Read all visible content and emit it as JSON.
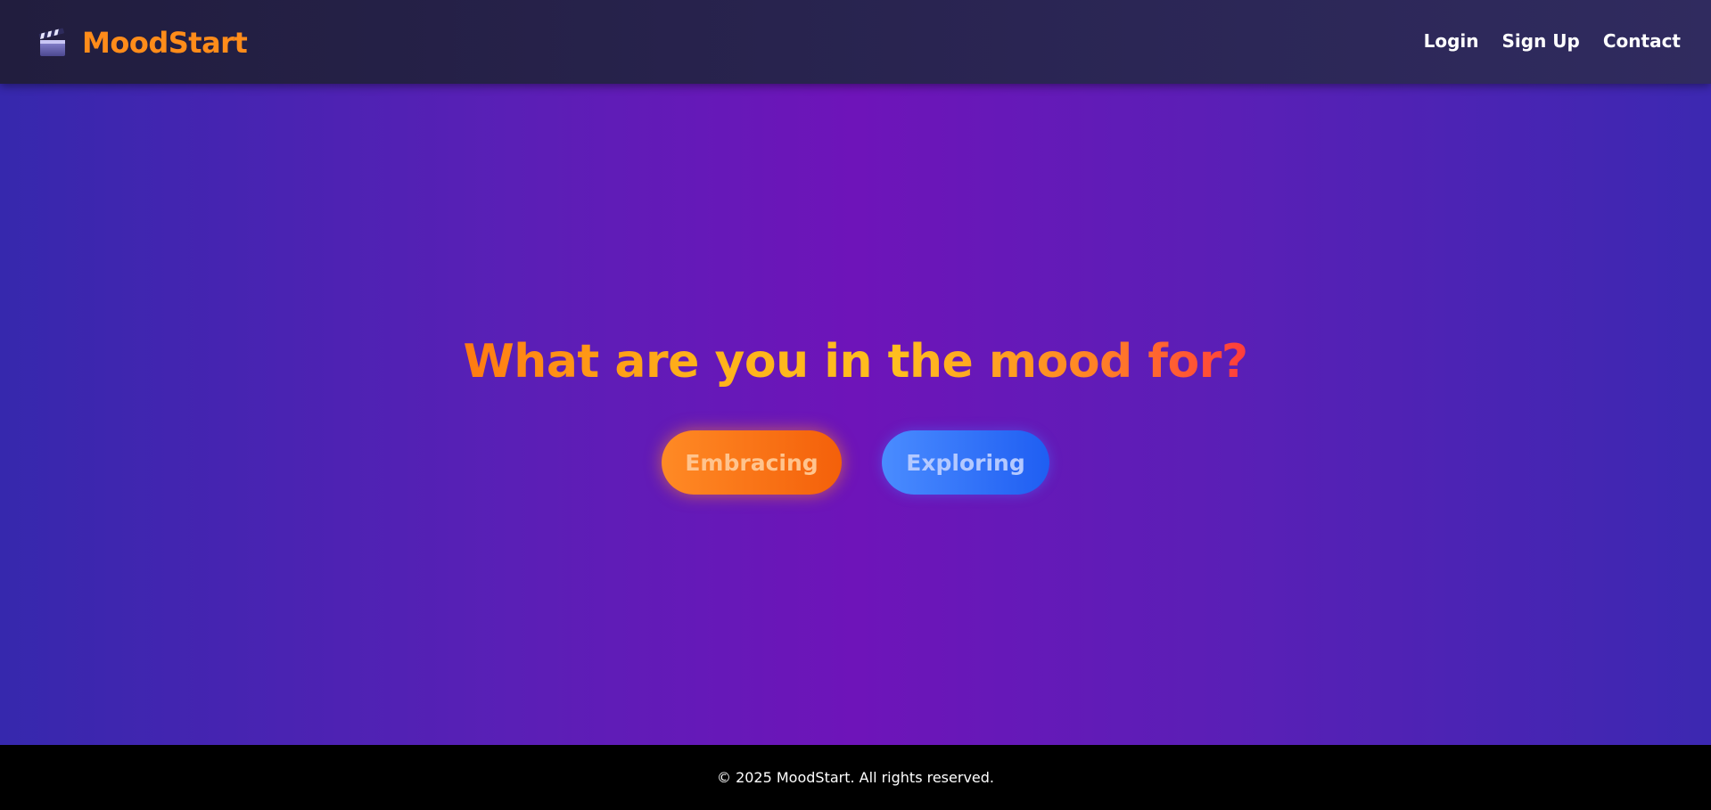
{
  "navbar": {
    "brand_icon": "clapperboard-icon",
    "brand_name": "MoodStart",
    "links": [
      {
        "label": "Login"
      },
      {
        "label": "Sign Up"
      },
      {
        "label": "Contact"
      }
    ]
  },
  "hero": {
    "headline": "What are you in the mood for?",
    "buttons": [
      {
        "label": "Embracing"
      },
      {
        "label": "Exploring"
      }
    ]
  },
  "footer": {
    "text": "© 2025 MoodStart. All rights reserved."
  },
  "colors": {
    "brand": "#ff8c1a",
    "navbar_bg": "#262149",
    "hero_center": "#6e14b9",
    "hero_edge": "#3628ad",
    "embrace_button": "#f77614",
    "explore_button": "#3372fa",
    "footer_bg": "#000000"
  }
}
